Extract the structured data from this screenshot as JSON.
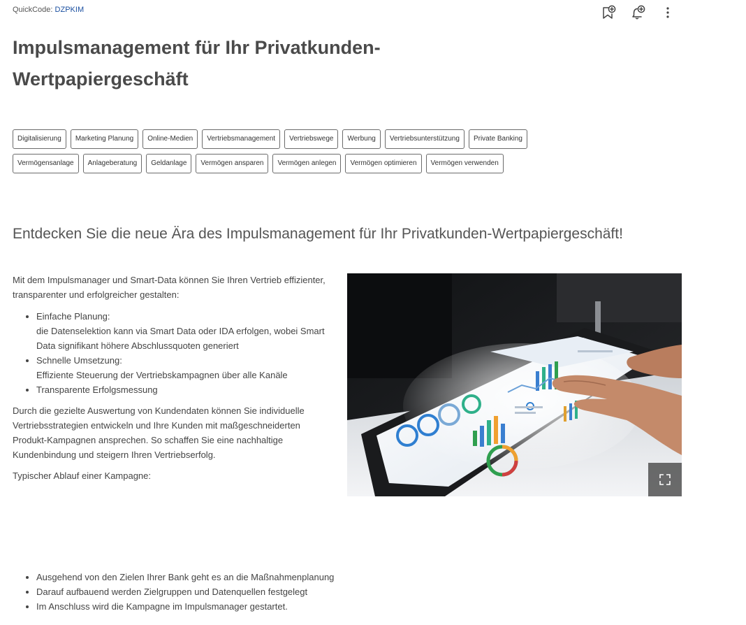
{
  "header": {
    "quickcode_label": "QuickCode:",
    "quickcode_value": "DZPKIM"
  },
  "title": "Impulsmanagement für Ihr Privatkunden-Wertpapiergeschäft",
  "tags": {
    "row1": [
      "Digitalisierung",
      "Marketing Planung",
      "Online-Medien",
      "Vertriebsmanagement",
      "Vertriebswege",
      "Werbung",
      "Vertriebsunterstützung",
      "Private Banking"
    ],
    "row2": [
      "Vermögensanlage",
      "Anlageberatung",
      "Geldanlage",
      "Vermögen ansparen",
      "Vermögen anlegen",
      "Vermögen optimieren",
      "Vermögen verwenden"
    ]
  },
  "subtitle": "Entdecken Sie die neue Ära des Impulsmanagement für Ihr Privatkunden-Wertpapiergeschäft!",
  "content": {
    "intro": "Mit dem Impulsmanager und Smart-Data können Sie Ihren Vertrieb effizienter, transparenter und erfolgreicher gestalten:",
    "features": [
      {
        "title": "Einfache Planung:",
        "desc": "die Datenselektion kann via Smart Data oder IDA erfolgen, wobei Smart Data signifikant höhere Abschlussquoten generiert"
      },
      {
        "title": "Schnelle Umsetzung:",
        "desc": "Effiziente Steuerung der Vertriebskampagnen über alle Kanäle"
      },
      {
        "title": "Transparente Erfolgsmessung",
        "desc": ""
      }
    ],
    "paragraph2": "Durch die gezielte Auswertung von Kundendaten können Sie individuelle Vertriebsstrategien entwickeln und Ihre Kunden mit maßgeschneiderten Produkt-Kampagnen ansprechen. So schaffen Sie eine nachhaltige  Kundenbindung und steigern Ihren Vertriebserfolg.",
    "process_label": "Typischer Ablauf einer Kampagne:",
    "process_steps": [
      "Ausgehend von den Zielen Ihrer Bank geht es an die Maßnahmenplanung",
      "Darauf aufbauend werden Zielgruppen und Datenquellen festgelegt",
      "Im Anschluss wird die Kampagne im Impulsmanager gestartet."
    ]
  },
  "icons": {
    "bookmark": "bookmark-add-icon",
    "bell": "notification-add-icon",
    "more": "more-vertical-icon",
    "expand": "fullscreen-icon"
  },
  "colors": {
    "quickcode_link": "#1a4fa0",
    "title": "#4a4a4a",
    "tag_border": "#6b6b6b"
  }
}
